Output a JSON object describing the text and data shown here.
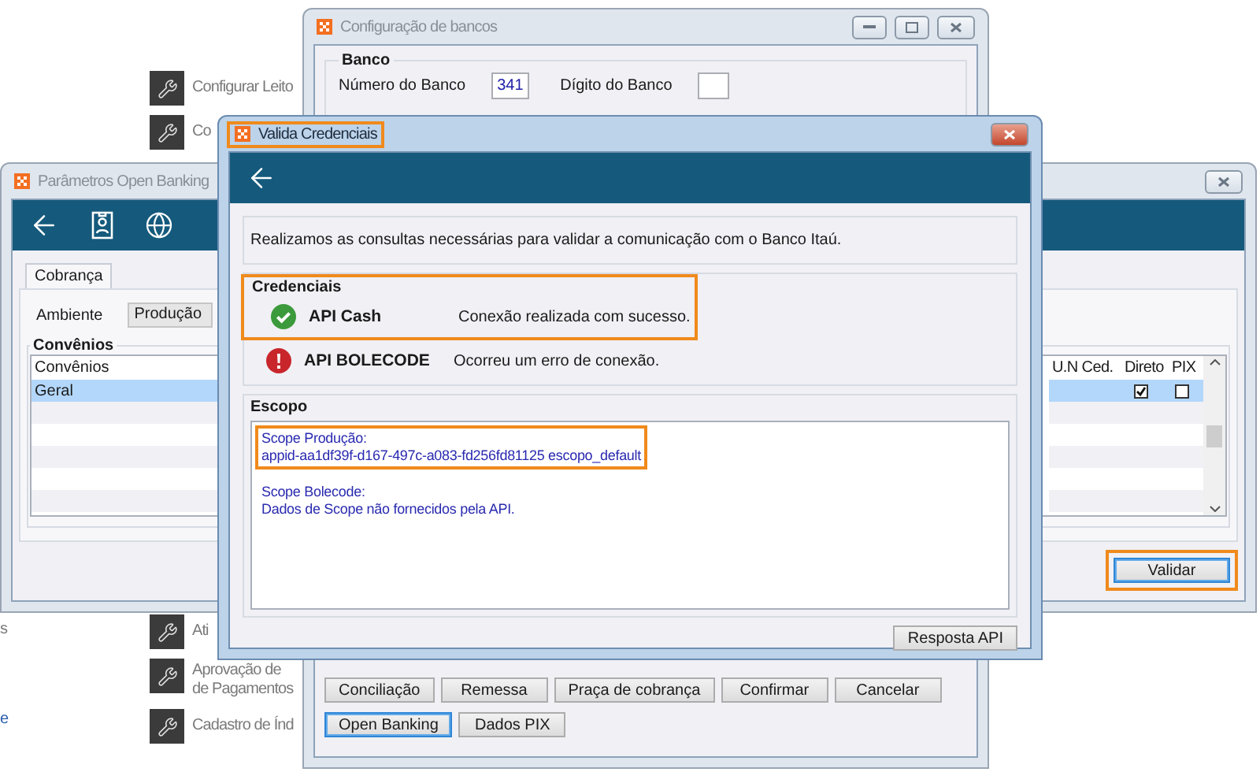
{
  "launcher": {
    "top_items": [
      {
        "lines": [
          "Configurar Leito"
        ]
      },
      {
        "lines": [
          "Co"
        ]
      }
    ],
    "bottom_items": [
      {
        "lines": [
          "Ati"
        ]
      },
      {
        "lines": [
          "Aprovação de",
          "de Pagamentos"
        ]
      },
      {
        "lines": [
          "Cadastro de Índ"
        ]
      }
    ],
    "edge_texts": [
      {
        "text": "s",
        "link": false
      },
      {
        "text": "e",
        "link": true
      }
    ]
  },
  "config_window": {
    "title": "Configuração de bancos",
    "group": "Banco",
    "fields": [
      {
        "label": "Número do Banco",
        "value": "341"
      },
      {
        "label": "Dígito do Banco"
      }
    ],
    "button_rows": [
      [
        {
          "label": "Conciliação",
          "focused": false
        },
        {
          "label": "Remessa",
          "focused": false
        },
        {
          "label": "Praça de cobrança",
          "focused": false
        },
        {
          "label": "Confirmar",
          "focused": false
        },
        {
          "label": "Cancelar",
          "focused": false
        }
      ],
      [
        {
          "label": "Open Banking",
          "focused": true
        },
        {
          "label": "Dados PIX",
          "focused": false
        }
      ]
    ]
  },
  "params_window": {
    "title": "Parâmetros Open Banking",
    "tabs": [
      {
        "label": "Cobrança",
        "selected": true
      }
    ],
    "ambiente": {
      "label": "Ambiente",
      "value": "Produção"
    },
    "group": "Convênios",
    "columns": [
      "Convênios",
      "U.N Ced.",
      "Direto",
      "PIX"
    ],
    "rows": [
      {
        "convenio": "Geral",
        "direto": true,
        "pix": false,
        "selected": true
      }
    ],
    "validate_button": {
      "label": "Validar",
      "focused": true,
      "highlighted": true
    }
  },
  "validate_window": {
    "title": "Valida Credenciais",
    "title_highlighted": true,
    "message": "Realizamos as consultas necessárias para validar a comunicação com o Banco Itaú.",
    "credentials": {
      "title": "Credenciais",
      "highlighted": true,
      "items": [
        {
          "name": "API Cash",
          "kind": "success",
          "message": "Conexão realizada com sucesso."
        },
        {
          "name": "API BOLECODE",
          "kind": "error",
          "message": "Ocorreu um erro de conexão."
        }
      ]
    },
    "scope": {
      "title": "Escopo",
      "entries": [
        {
          "heading": "Scope Produção:",
          "text": "appid-aa1df39f-d167-497c-a083-fd256fd81125 escopo_default",
          "highlighted": true
        },
        {
          "heading": "Scope Bolecode:",
          "text": "Dados de Scope não fornecidos pela API.",
          "highlighted": false
        }
      ]
    },
    "button": "Resposta API"
  }
}
